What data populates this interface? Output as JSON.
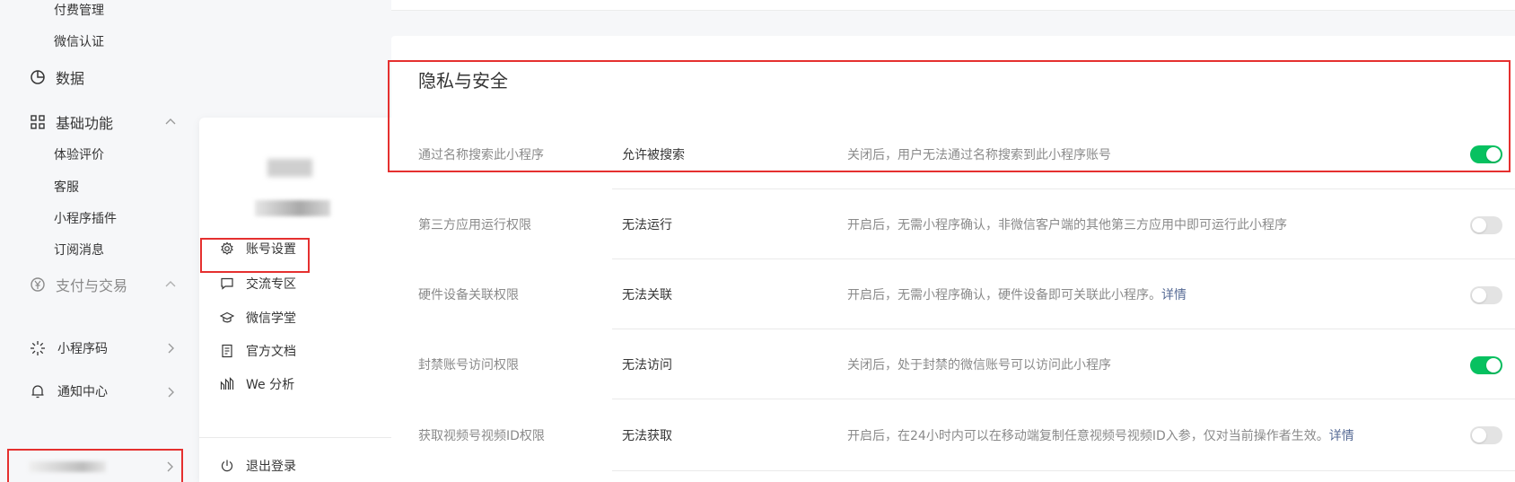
{
  "sidebar": {
    "sub_top": [
      "付费管理",
      "微信认证"
    ],
    "data_group": {
      "label": "数据",
      "icon": "pie-chart-icon"
    },
    "basic_group": {
      "label": "基础功能",
      "icon": "grid-icon",
      "items": [
        "体验评价",
        "客服",
        "小程序插件",
        "订阅消息"
      ]
    },
    "pay_group": {
      "label": "支付与交易",
      "icon": "yen-circle-icon"
    },
    "bottom": [
      {
        "label": "小程序码",
        "icon": "qr-sun-icon"
      },
      {
        "label": "通知中心",
        "icon": "bell-icon"
      }
    ]
  },
  "popup": {
    "items": [
      {
        "label": "账号设置",
        "icon": "gear-icon"
      },
      {
        "label": "交流专区",
        "icon": "chat-icon"
      },
      {
        "label": "微信学堂",
        "icon": "graduation-cap-icon"
      },
      {
        "label": "官方文档",
        "icon": "document-icon"
      },
      {
        "label": "We 分析",
        "icon": "analytics-icon"
      }
    ],
    "logout": {
      "label": "退出登录",
      "icon": "power-icon"
    }
  },
  "main": {
    "section_title": "隐私与安全",
    "rows": [
      {
        "label": "通过名称搜索此小程序",
        "value": "允许被搜索",
        "desc": "关闭后，用户无法通过名称搜索到此小程序账号",
        "link": "",
        "on": true
      },
      {
        "label": "第三方应用运行权限",
        "value": "无法运行",
        "desc": "开启后，无需小程序确认，非微信客户端的其他第三方应用中即可运行此小程序",
        "link": "",
        "on": false
      },
      {
        "label": "硬件设备关联权限",
        "value": "无法关联",
        "desc": "开启后，无需小程序确认，硬件设备即可关联此小程序。",
        "link": "详情",
        "on": false
      },
      {
        "label": "封禁账号访问权限",
        "value": "无法访问",
        "desc": "关闭后，处于封禁的微信账号可以访问此小程序",
        "link": "",
        "on": true
      },
      {
        "label": "获取视频号视频ID权限",
        "value": "无法获取",
        "desc": "开启后，在24小时内可以在移动端复制任意视频号视频ID入参，仅对当前操作者生效。",
        "link": "详情",
        "on": false
      }
    ]
  },
  "colors": {
    "accent_green": "#07c160",
    "highlight_red": "#e5302f",
    "link_blue": "#576b95"
  }
}
